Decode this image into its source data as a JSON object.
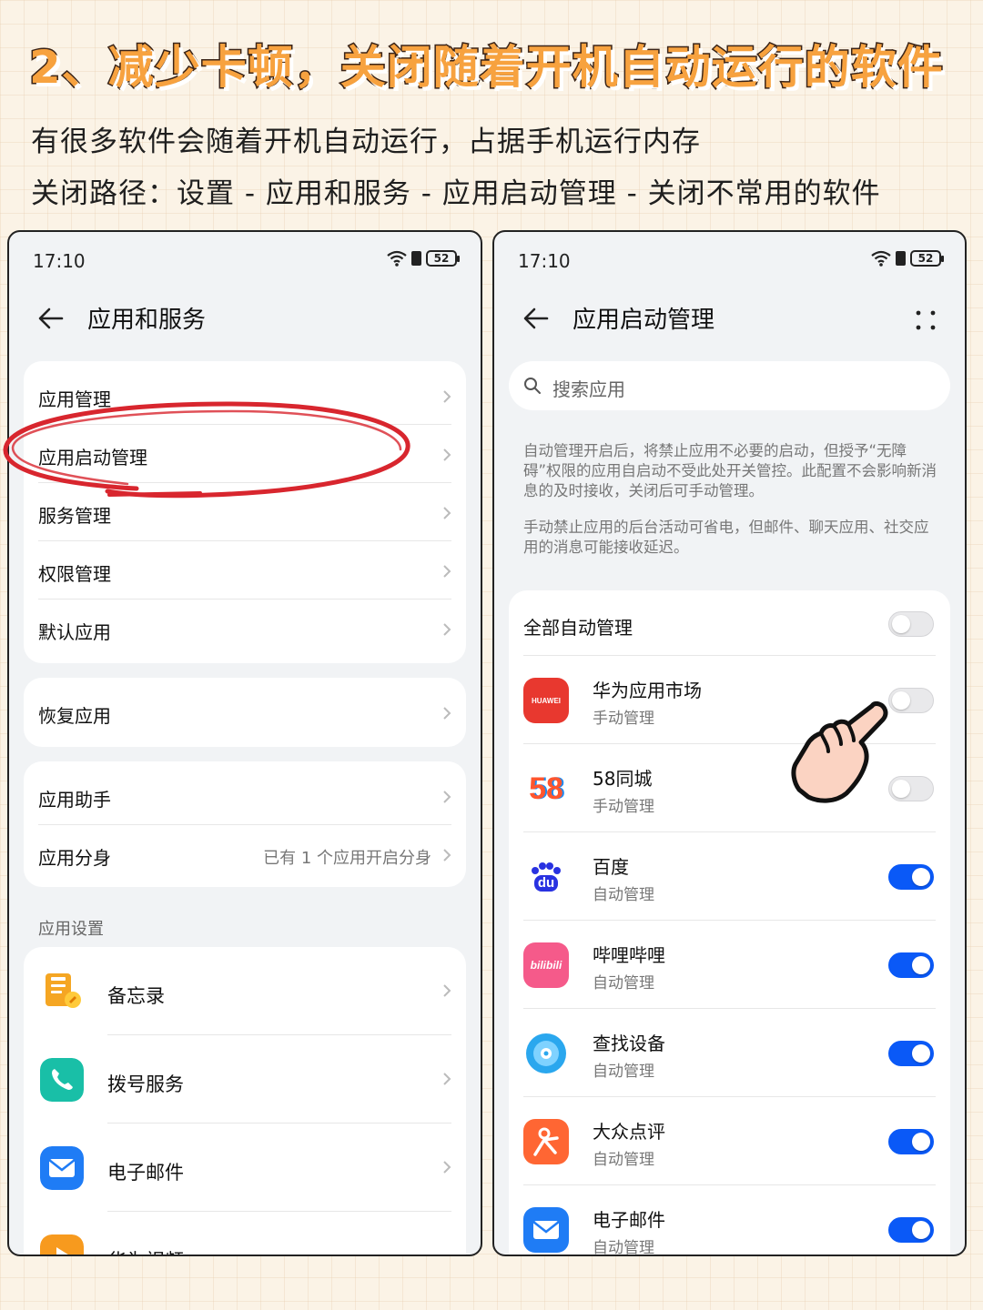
{
  "headline": "2、减少卡顿，关闭随着开机自动运行的软件",
  "subline_1": "有很多软件会随着开机自动运行，占据手机运行内存",
  "subline_2": "关闭路径：设置 - 应用和服务 - 应用启动管理 - 关闭不常用的软件",
  "left_screen": {
    "status": {
      "time": "17:10",
      "battery": "52"
    },
    "title": "应用和服务",
    "group1": [
      "应用管理",
      "应用启动管理",
      "服务管理",
      "权限管理",
      "默认应用"
    ],
    "group2": [
      "恢复应用"
    ],
    "group3": [
      {
        "label": "应用助手",
        "hint": ""
      },
      {
        "label": "应用分身",
        "hint": "已有 1 个应用开启分身"
      }
    ],
    "section_label": "应用设置",
    "apps": [
      "备忘录",
      "拨号服务",
      "电子邮件",
      "华为视频"
    ]
  },
  "right_screen": {
    "status": {
      "time": "17:10",
      "battery": "52"
    },
    "title": "应用启动管理",
    "search_placeholder": "搜索应用",
    "desc_1": "自动管理开启后，将禁止应用不必要的启动，但授予“无障碍”权限的应用自启动不受此处开关管控。此配置不会影响新消息的及时接收，关闭后可手动管理。",
    "desc_2": "手动禁止应用的后台活动可省电，但邮件、聊天应用、社交应用的消息可能接收延迟。",
    "all_auto_label": "全部自动管理",
    "all_auto_on": false,
    "apps": [
      {
        "name": "华为应用市场",
        "mode": "手动管理",
        "on": false,
        "icon": "huawei-appgallery-icon",
        "icon_text": "HUAWEI"
      },
      {
        "name": "58同城",
        "mode": "手动管理",
        "on": false,
        "icon": "58-tongcheng-icon",
        "icon_text": "58"
      },
      {
        "name": "百度",
        "mode": "自动管理",
        "on": true,
        "icon": "baidu-icon",
        "icon_text": "du"
      },
      {
        "name": "哔哩哔哩",
        "mode": "自动管理",
        "on": true,
        "icon": "bilibili-icon",
        "icon_text": "bilibili"
      },
      {
        "name": "查找设备",
        "mode": "自动管理",
        "on": true,
        "icon": "find-device-icon",
        "icon_text": ""
      },
      {
        "name": "大众点评",
        "mode": "自动管理",
        "on": true,
        "icon": "dianping-icon",
        "icon_text": ""
      },
      {
        "name": "电子邮件",
        "mode": "自动管理",
        "on": true,
        "icon": "email-icon",
        "icon_text": ""
      }
    ]
  },
  "colors": {
    "accent": "#0a59f7",
    "highlight": "#d8262e",
    "headline": "#f7a23f"
  }
}
